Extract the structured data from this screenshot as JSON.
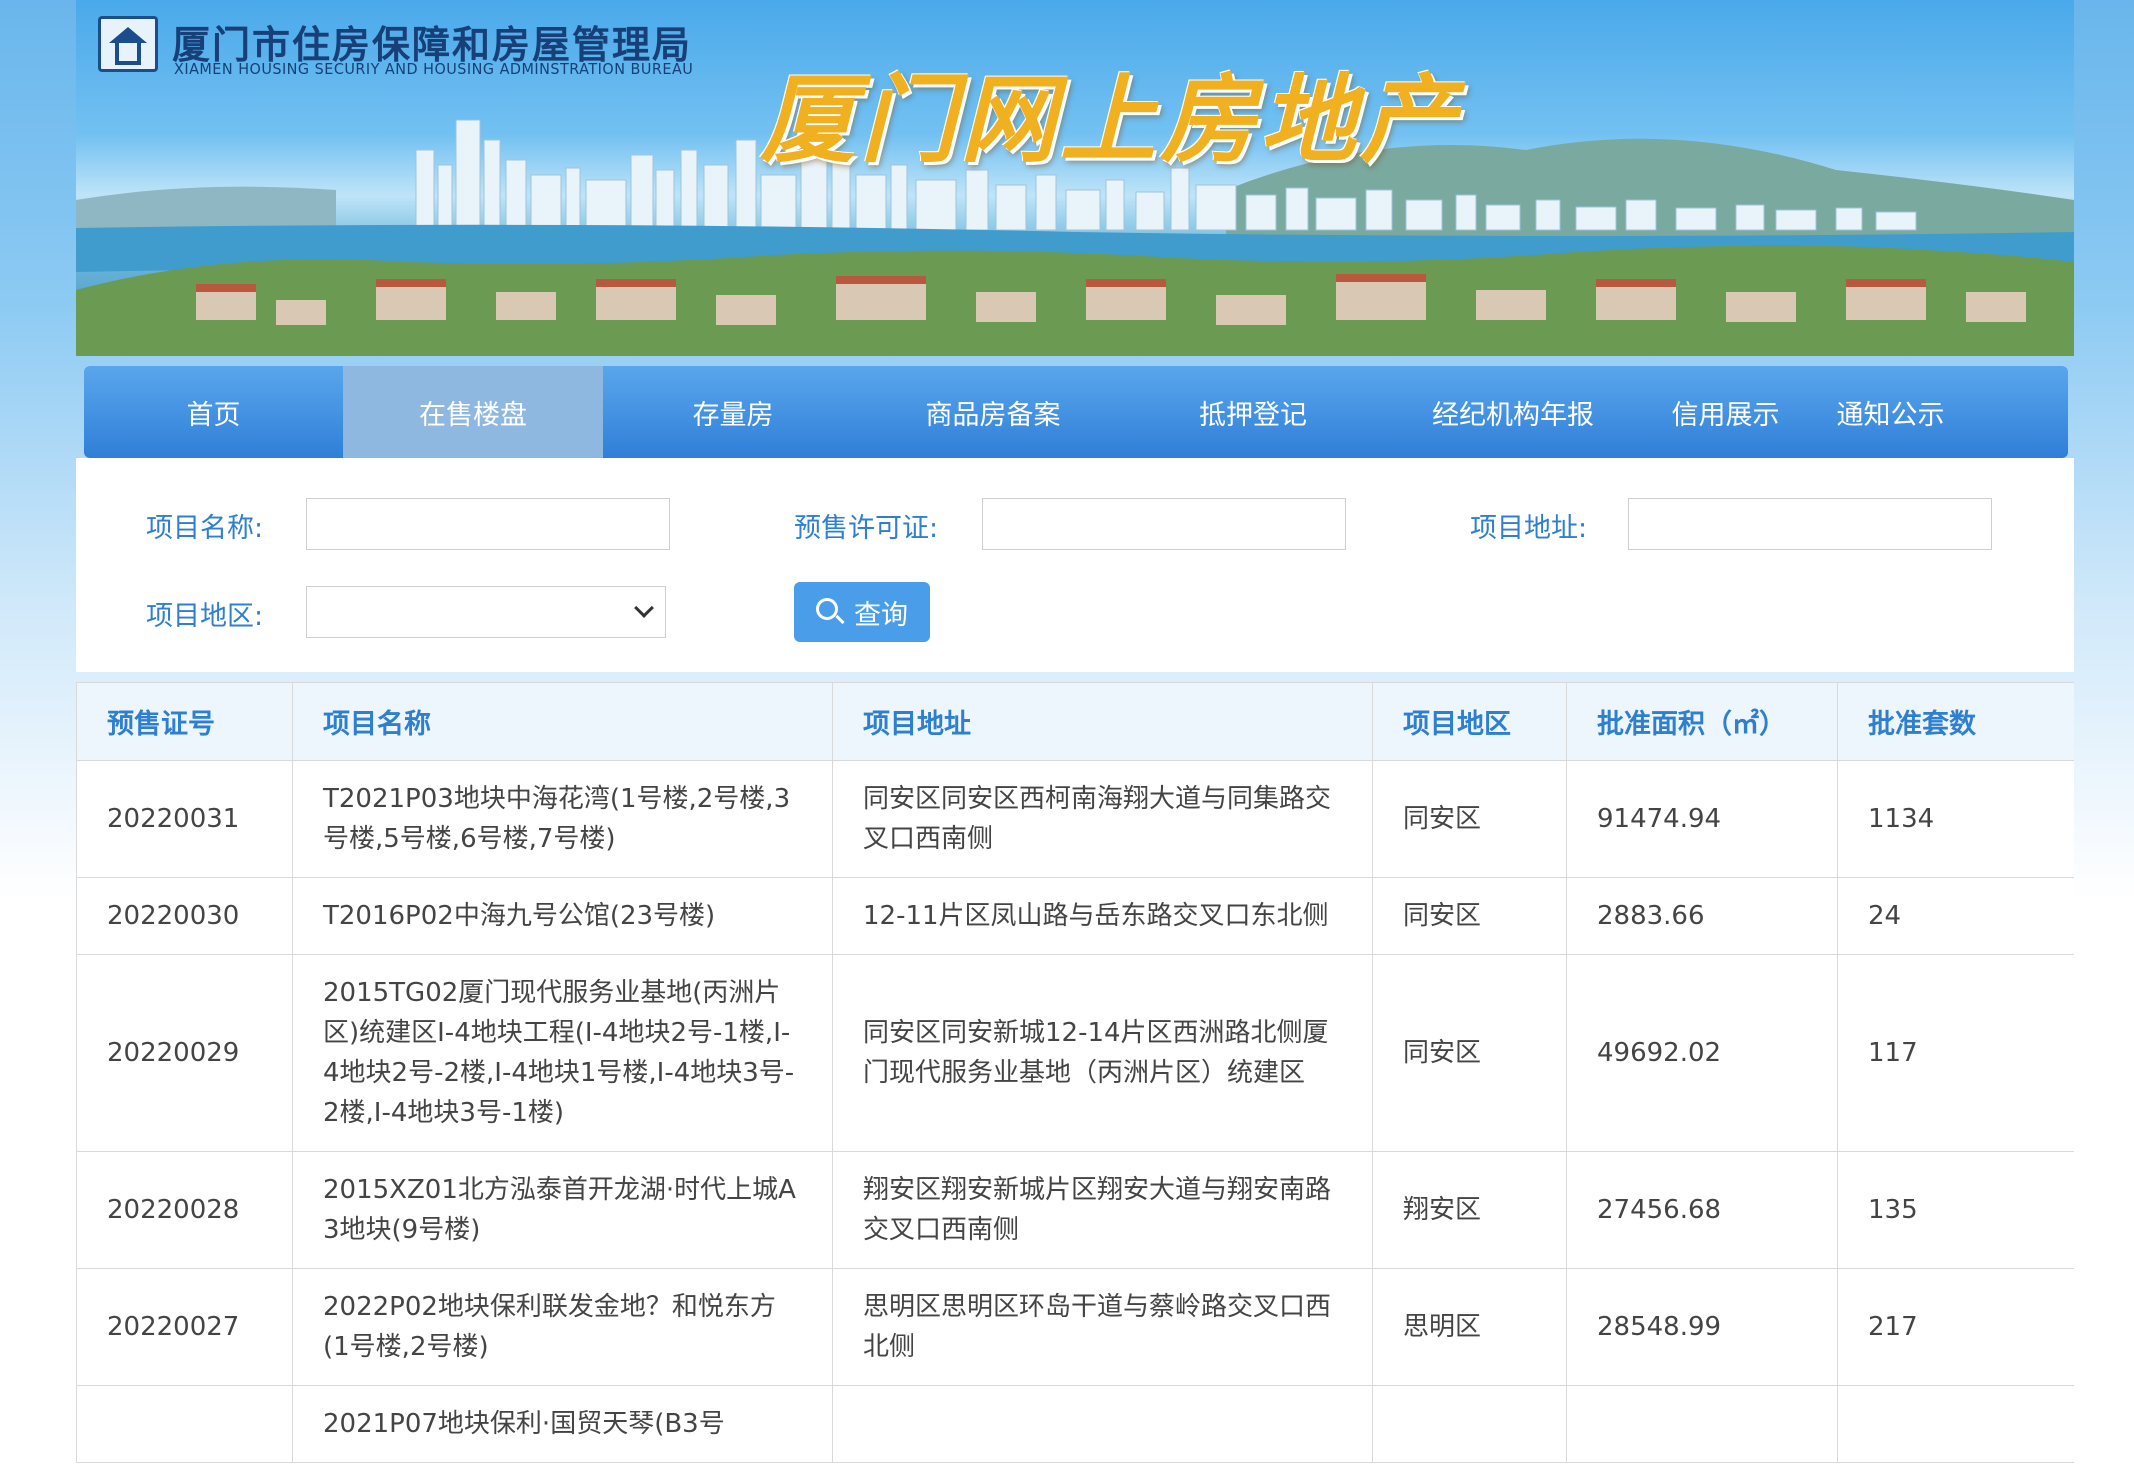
{
  "header": {
    "org_name": "厦门市住房保障和房屋管理局",
    "org_name_en": "XIAMEN HOUSING SECURIY AND HOUSING ADMINSTRATION BUREAU",
    "site_title": "厦门网上房地产",
    "logo_icon": "house-logo-icon"
  },
  "nav": {
    "items": [
      {
        "label": "首页",
        "active": false
      },
      {
        "label": "在售楼盘",
        "active": true
      },
      {
        "label": "存量房",
        "active": false
      },
      {
        "label": "商品房备案",
        "active": false
      },
      {
        "label": "抵押登记",
        "active": false
      },
      {
        "label": "经纪机构年报",
        "active": false
      },
      {
        "label": "信用展示",
        "active": false
      },
      {
        "label": "通知公示",
        "active": false
      }
    ]
  },
  "search": {
    "project_name_label": "项目名称:",
    "project_name_value": "",
    "presale_permit_label": "预售许可证:",
    "presale_permit_value": "",
    "project_address_label": "项目地址:",
    "project_address_value": "",
    "project_area_label": "项目地区:",
    "project_area_value": "",
    "search_button_label": "查询",
    "search_icon": "search-icon"
  },
  "table": {
    "headers": [
      "预售证号",
      "项目名称",
      "项目地址",
      "项目地区",
      "批准面积（㎡）",
      "批准套数"
    ],
    "rows": [
      [
        "20220031",
        "T2021P03地块中海花湾(1号楼,2号楼,3号楼,5号楼,6号楼,7号楼)",
        "同安区同安区西柯南海翔大道与同集路交叉口西南侧",
        "同安区",
        "91474.94",
        "1134"
      ],
      [
        "20220030",
        "T2016P02中海九号公馆(23号楼)",
        "12-11片区凤山路与岳东路交叉口东北侧",
        "同安区",
        "2883.66",
        "24"
      ],
      [
        "20220029",
        "2015TG02厦门现代服务业基地(丙洲片区)统建区I-4地块工程(I-4地块2号-1楼,I-4地块2号-2楼,I-4地块1号楼,I-4地块3号-2楼,I-4地块3号-1楼)",
        "同安区同安新城12-14片区西洲路北侧厦门现代服务业基地（丙洲片区）统建区",
        "同安区",
        "49692.02",
        "117"
      ],
      [
        "20220028",
        "2015XZ01北方泓泰首开龙湖·时代上城A3地块(9号楼)",
        "翔安区翔安新城片区翔安大道与翔安南路交叉口西南侧",
        "翔安区",
        "27456.68",
        "135"
      ],
      [
        "20220027",
        "2022P02地块保利联发金地？和悦东方(1号楼,2号楼)",
        "思明区思明区环岛干道与蔡岭路交叉口西北侧",
        "思明区",
        "28548.99",
        "217"
      ],
      [
        "",
        "2021P07地块保利·国贸天琴(B3号",
        "",
        "",
        "",
        ""
      ]
    ]
  }
}
